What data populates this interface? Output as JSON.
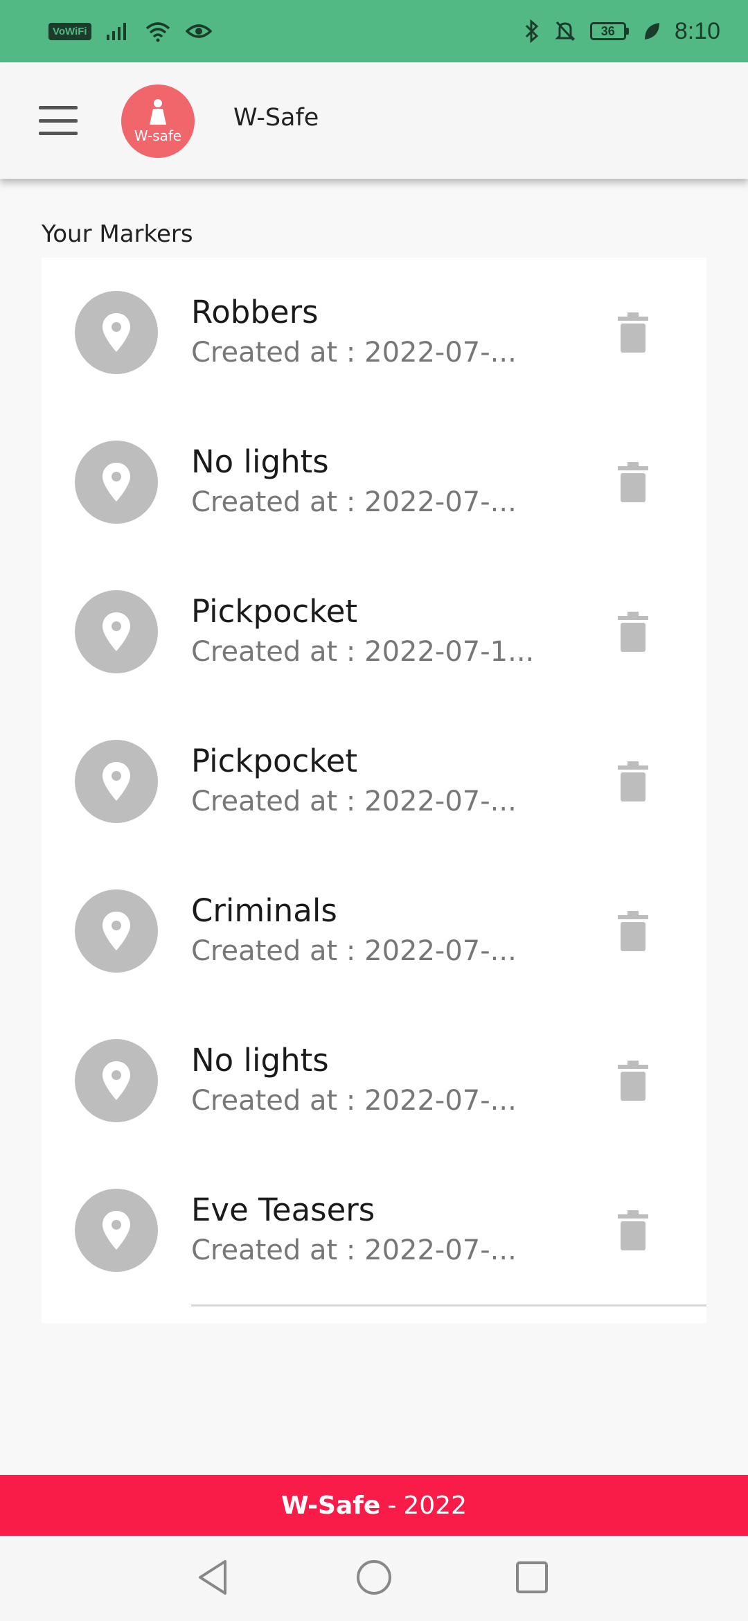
{
  "status_bar": {
    "network_label": "VoWiFi",
    "battery_level": "36",
    "time": "8:10",
    "icons": [
      "signal-icon",
      "wifi-icon",
      "eye-icon",
      "bluetooth-icon",
      "mute-bell-icon",
      "leaf-icon"
    ]
  },
  "app_bar": {
    "title": "W-Safe",
    "logo_text": "W-safe",
    "menu_icon": "hamburger-menu-icon"
  },
  "section": {
    "title": "Your Markers"
  },
  "markers": [
    {
      "title": "Robbers",
      "subtitle": "Created at : 2022-07-..."
    },
    {
      "title": "No lights",
      "subtitle": "Created at : 2022-07-..."
    },
    {
      "title": "Pickpocket",
      "subtitle": "Created at : 2022-07-1..."
    },
    {
      "title": "Pickpocket",
      "subtitle": "Created at : 2022-07-..."
    },
    {
      "title": "Criminals",
      "subtitle": "Created at : 2022-07-..."
    },
    {
      "title": "No lights",
      "subtitle": "Created at : 2022-07-..."
    },
    {
      "title": "Eve Teasers",
      "subtitle": "Created at : 2022-07-..."
    }
  ],
  "footer": {
    "brand": "W-Safe",
    "separator": "-",
    "year": "2022"
  },
  "colors": {
    "status_bar": "#52b985",
    "footer": "#fa1c48",
    "logo": "#f1666b",
    "avatar": "#bdbdbd"
  }
}
